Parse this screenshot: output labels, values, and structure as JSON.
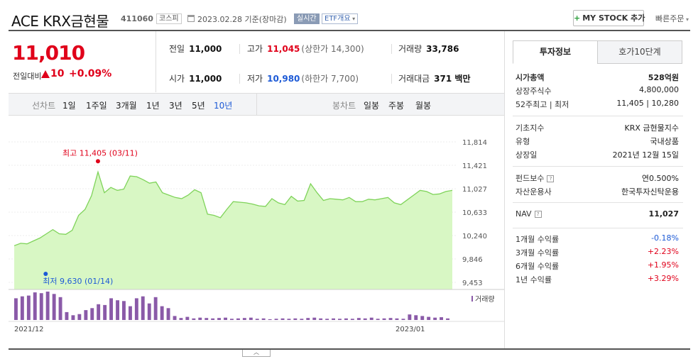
{
  "header": {
    "name": "ACE KRX금현물",
    "code": "411060",
    "market": "코스피",
    "date": "2023.02.28 기준(장마감)",
    "live": "실시간",
    "etf": "ETF개요",
    "mystock": "MY STOCK 추가",
    "quick": "빠른주문"
  },
  "price": {
    "current": "11,010",
    "change_label": "전일대비",
    "change": "10",
    "pct": "+0.09%"
  },
  "stats": {
    "prev_label": "전일",
    "prev": "11,000",
    "high_label": "고가",
    "high": "11,045",
    "upper": "(상한가 14,300)",
    "vol_label": "거래량",
    "vol": "33,786",
    "open_label": "시가",
    "open": "11,000",
    "low_label": "저가",
    "low": "10,980",
    "lower": "(하한가 7,700)",
    "amt_label": "거래대금",
    "amt": "371 백만"
  },
  "periods": {
    "line_label": "선차트",
    "items": [
      "1일",
      "1주일",
      "3개월",
      "1년",
      "3년",
      "5년",
      "10년"
    ],
    "candle_label": "봉차트",
    "candles": [
      "일봉",
      "주봉",
      "월봉"
    ]
  },
  "tabs": [
    "투자정보",
    "호가10단계"
  ],
  "info": {
    "cap_label": "시가총액",
    "cap": "528억원",
    "shares_label": "상장주식수",
    "shares": "4,800,000",
    "range_label": "52주최고 | 최저",
    "range": "11,405 | 10,280",
    "index_label": "기초지수",
    "index": "KRX 금현물지수",
    "type_label": "유형",
    "type": "국내상품",
    "listed_label": "상장일",
    "listed": "2021년 12월 15일",
    "fee_label": "펀드보수",
    "fee": "연0.500%",
    "mgr_label": "자산운용사",
    "mgr": "한국투자신탁운용",
    "nav_label": "NAV",
    "nav": "11,027",
    "r1_label": "1개월 수익률",
    "r1": "-0.18%",
    "r3_label": "3개월 수익률",
    "r3": "+2.23%",
    "r6_label": "6개월 수익률",
    "r6": "+1.95%",
    "r12_label": "1년 수익률",
    "r12": "+3.29%"
  },
  "chart_data": {
    "type": "area",
    "y_ticks": [
      "11,814",
      "11,421",
      "11,027",
      "10,633",
      "10,240",
      "9,846",
      "9,453"
    ],
    "x_labels": [
      "2021/12",
      "2023/01"
    ],
    "ylim": [
      9453,
      11814
    ],
    "values": [
      10070,
      10110,
      10100,
      10150,
      10200,
      10270,
      10340,
      10270,
      10260,
      10330,
      10580,
      10680,
      10910,
      11310,
      10960,
      11050,
      11000,
      11020,
      11240,
      11230,
      11180,
      11120,
      11140,
      10960,
      10920,
      10880,
      10860,
      10920,
      11010,
      10960,
      10600,
      10580,
      10540,
      10680,
      10810,
      10800,
      10790,
      10770,
      10740,
      10730,
      10860,
      10790,
      10760,
      10900,
      10820,
      10830,
      11110,
      10960,
      10830,
      10860,
      10850,
      10840,
      10880,
      10810,
      10810,
      10850,
      10840,
      10860,
      10880,
      10790,
      10760,
      10840,
      10920,
      11000,
      10980,
      10930,
      10940,
      10980,
      11000
    ],
    "high_label": "최고 11,405 (03/11)",
    "low_label": "최저 9,630 (01/14)",
    "volume_label": "거래량",
    "volume": [
      55,
      60,
      62,
      70,
      68,
      72,
      66,
      58,
      20,
      12,
      15,
      25,
      30,
      40,
      38,
      55,
      50,
      48,
      35,
      55,
      60,
      42,
      58,
      35,
      30,
      10,
      5,
      8,
      4,
      6,
      5,
      4,
      5,
      6,
      3,
      4,
      5,
      6,
      3,
      4,
      2,
      3,
      4,
      3,
      4,
      3,
      5,
      6,
      4,
      3,
      4,
      3,
      4,
      3,
      5,
      4,
      6,
      3,
      4,
      5,
      4,
      3,
      14,
      12,
      10,
      8,
      6,
      7,
      4
    ]
  }
}
